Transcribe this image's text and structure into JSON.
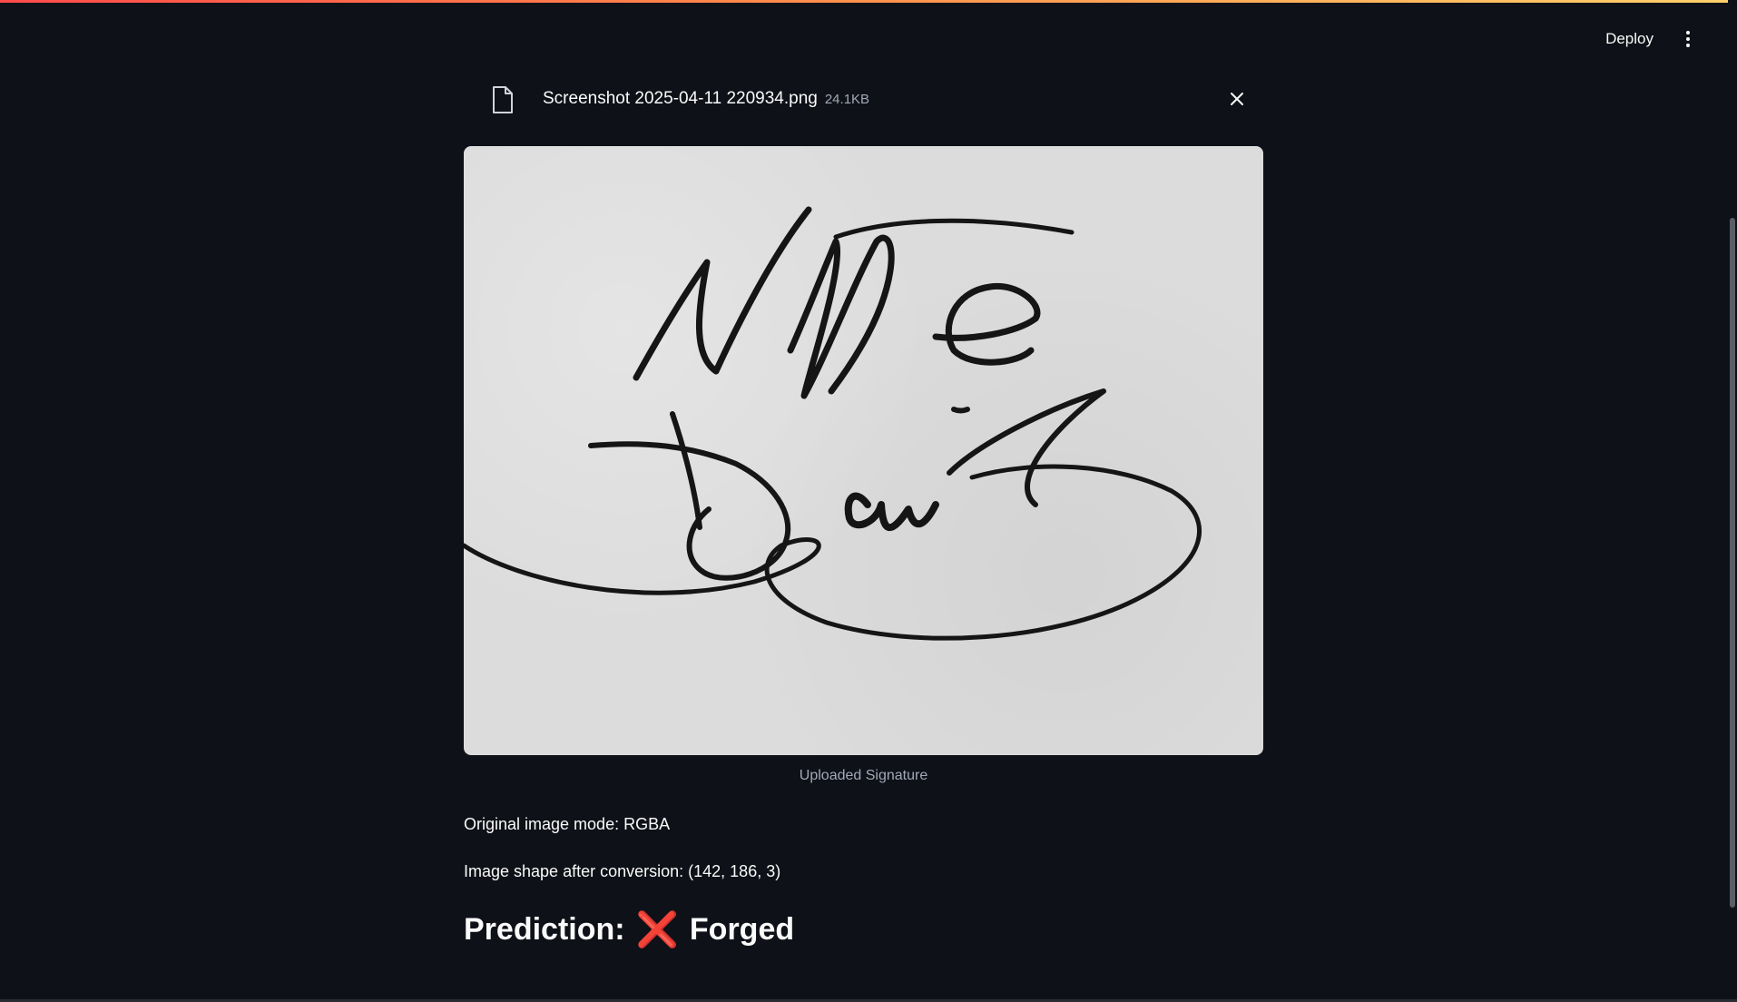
{
  "header": {
    "deploy_label": "Deploy",
    "menu_icon": "kebab-menu-icon"
  },
  "uploader": {
    "file_icon": "file-icon",
    "file_name": "Screenshot 2025-04-11 220934.png",
    "file_size": "24.1KB",
    "close_icon": "close-icon"
  },
  "image": {
    "caption": "Uploaded Signature",
    "signature_text": "Nite Dais"
  },
  "info": {
    "mode_line": "Original image mode: RGBA",
    "shape_line": "Image shape after conversion: (142, 186, 3)"
  },
  "prediction": {
    "label": "Prediction:",
    "mark": "❌",
    "result": "Forged",
    "mark_color": "#ff2d55"
  },
  "colors": {
    "background": "#0e1117",
    "accent": "#ff4b4b"
  }
}
